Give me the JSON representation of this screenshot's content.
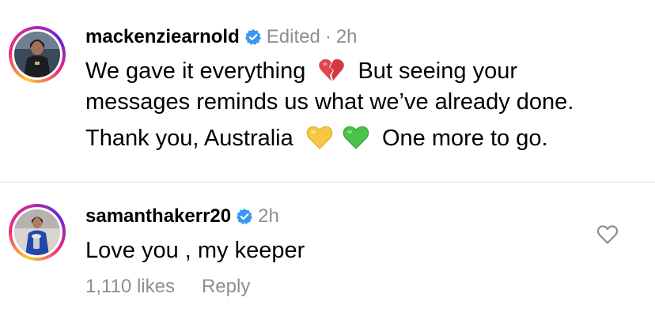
{
  "caption": {
    "username": "mackenziearnold",
    "edited_label": "Edited",
    "separator": "·",
    "time": "2h",
    "line1_a": "We gave it everything",
    "line1_b": "But seeing your",
    "line2": "messages reminds us what we’ve already done.",
    "line3_a": "Thank you, Australia",
    "line3_b": "One more to go.",
    "emojis": [
      "broken-heart",
      "yellow-heart",
      "green-heart"
    ]
  },
  "comment": {
    "username": "samanthakerr20",
    "time": "2h",
    "text": "Love you , my keeper",
    "likes": "1,110 likes",
    "reply_label": "Reply"
  },
  "colors": {
    "text": "#000000",
    "muted": "#8e8e8e",
    "verified": "#3897f0",
    "divider": "#dbdbdb"
  }
}
